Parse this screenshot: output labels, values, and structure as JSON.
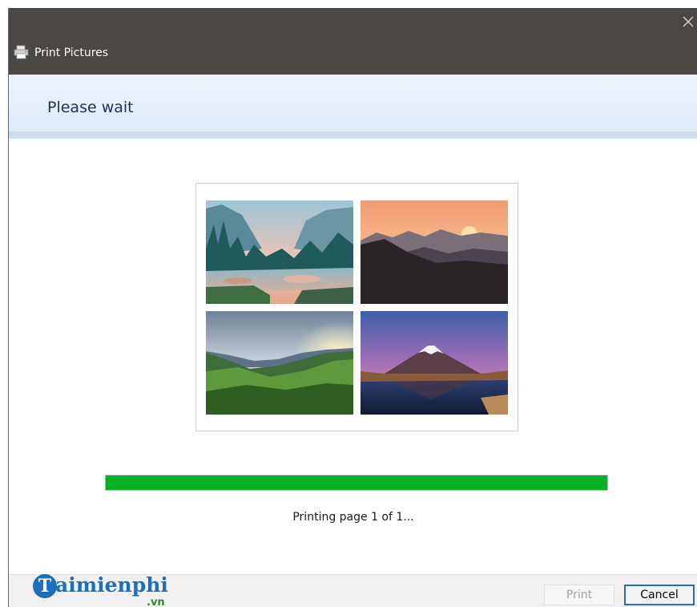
{
  "window": {
    "title": "Print Pictures"
  },
  "header": {
    "title": "Please wait"
  },
  "preview": {
    "photos": [
      {
        "id": "forest-river-icon"
      },
      {
        "id": "mountain-sunset-icon"
      },
      {
        "id": "green-hills-icon"
      },
      {
        "id": "snow-volcano-icon"
      }
    ]
  },
  "progress": {
    "value": 1.0,
    "color": "#06b025"
  },
  "status": {
    "text": "Printing page 1 of 1..."
  },
  "footer": {
    "logo_initial": "T",
    "logo_text": "aimienphi",
    "logo_suffix": ".vn",
    "print_label": "Print",
    "cancel_label": "Cancel"
  },
  "colors": {
    "titlebar": "#4a4745",
    "accent": "#2d6ab4",
    "header_text": "#1e3155"
  }
}
